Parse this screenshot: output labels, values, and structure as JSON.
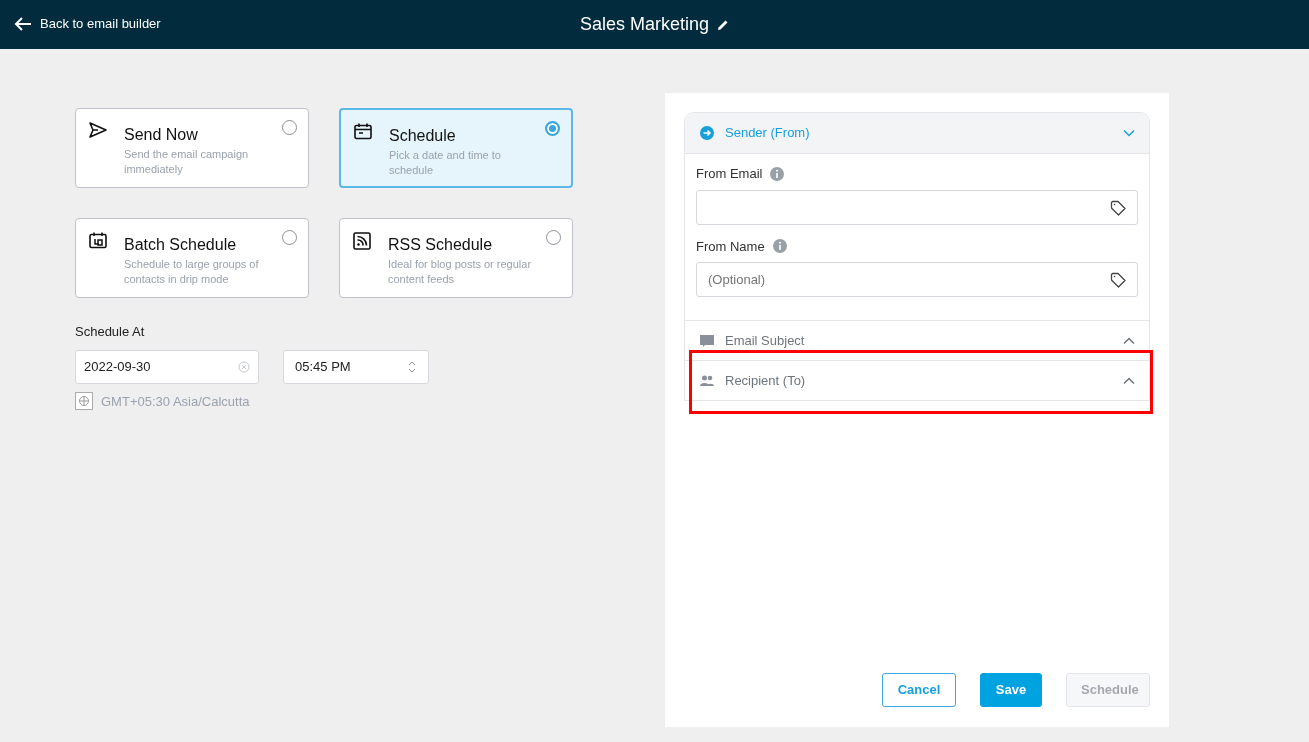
{
  "header": {
    "back_label": "Back to email builder",
    "title": "Sales Marketing"
  },
  "options": [
    {
      "title": "Send Now",
      "description": "Send the email campaign immediately",
      "selected": false
    },
    {
      "title": "Schedule",
      "description": "Pick a date and time to schedule",
      "selected": true
    },
    {
      "title": "Batch Schedule",
      "description": "Schedule to large groups of contacts in drip mode",
      "selected": false
    },
    {
      "title": "RSS Schedule",
      "description": "Ideal for blog posts or regular content feeds",
      "selected": false
    }
  ],
  "schedule_at": {
    "label": "Schedule At",
    "date": "2022-09-30",
    "time": "05:45 PM",
    "timezone": "GMT+05:30 Asia/Calcutta"
  },
  "sections": [
    {
      "title": "Sender (From)",
      "expanded": true,
      "highlighted": false,
      "fields": [
        {
          "label": "From Email"
        },
        {
          "label": "From Name",
          "placeholder": "(Optional)"
        }
      ]
    },
    {
      "title": "Email Subject",
      "expanded": false,
      "highlighted": false
    },
    {
      "title": "Recipient (To)",
      "expanded": false,
      "highlighted": true
    }
  ],
  "buttons": [
    {
      "kind": "outline",
      "label": "Cancel",
      "disabled": false
    },
    {
      "kind": "primary",
      "label": "Save",
      "disabled": false
    },
    {
      "kind": "primary",
      "label": "Schedule",
      "disabled": true
    }
  ]
}
